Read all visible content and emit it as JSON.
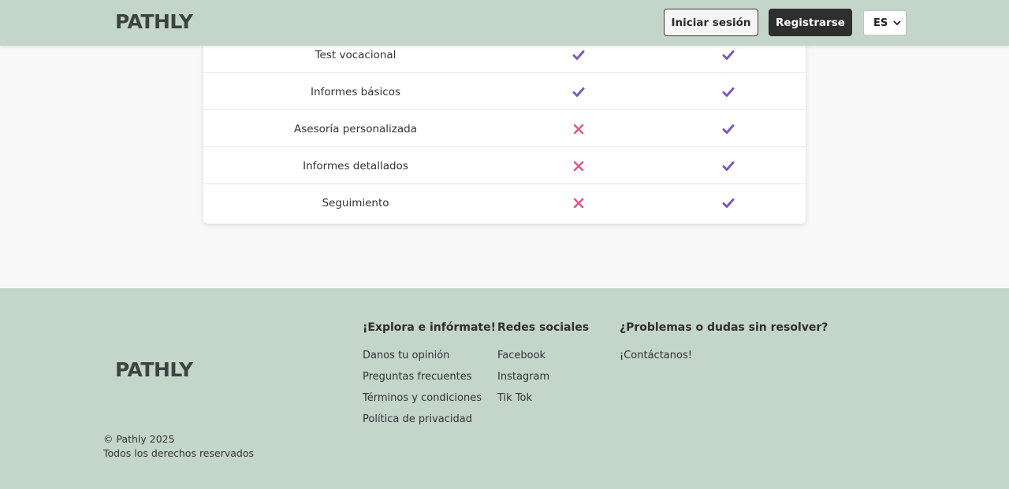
{
  "header": {
    "logo": "PATHLY",
    "login_label": "Iniciar sesión",
    "register_label": "Registrarse",
    "language": "ES"
  },
  "comparison": {
    "rows": [
      {
        "feature": "Test vocacional",
        "col1": "check",
        "col2": "check"
      },
      {
        "feature": "Informes básicos",
        "col1": "check",
        "col2": "check"
      },
      {
        "feature": "Asesoría personalizada",
        "col1": "cross",
        "col2": "check"
      },
      {
        "feature": "Informes detallados",
        "col1": "cross",
        "col2": "check"
      },
      {
        "feature": "Seguimiento",
        "col1": "cross",
        "col2": "check"
      }
    ],
    "colors": {
      "check": "#7d5ab5",
      "cross": "#e05a8a"
    }
  },
  "footer": {
    "logo": "PATHLY",
    "explore": {
      "title": "¡Explora e infórmate!",
      "links": [
        "Danos tu opinión",
        "Preguntas frecuentes",
        "Términos y condiciones",
        "Política de privacidad"
      ]
    },
    "social": {
      "title": "Redes sociales",
      "links": [
        "Facebook",
        "Instagram",
        "Tik Tok"
      ]
    },
    "help": {
      "title": "¿Problemas o dudas sin resolver?",
      "links": [
        "¡Contáctanos!"
      ]
    },
    "copyright": "© Pathly 2025",
    "rights": "Todos los derechos reservados"
  }
}
